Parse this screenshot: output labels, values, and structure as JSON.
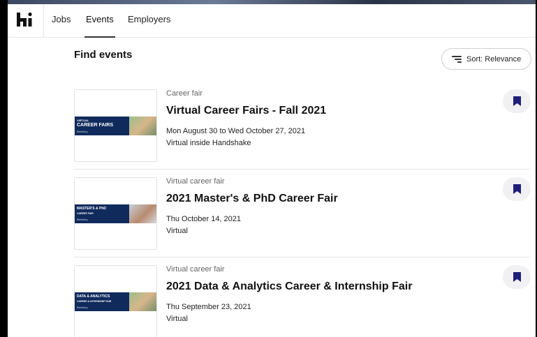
{
  "nav": {
    "tabs": [
      {
        "label": "Jobs"
      },
      {
        "label": "Events",
        "active": true
      },
      {
        "label": "Employers"
      }
    ]
  },
  "header": {
    "title": "Find events",
    "sort_label": "Sort: Relevance"
  },
  "events": [
    {
      "type": "Career fair",
      "title": "Virtual Career Fairs - Fall 2021",
      "date": "Mon August 30 to Wed October 27, 2021",
      "location": "Virtual inside Handshake",
      "banner_title": "CAREER FAIRS",
      "banner_kicker": "VIRTUAL",
      "banner_sub": "Berkeley",
      "bookmarked": true
    },
    {
      "type": "Virtual career fair",
      "title": "2021 Master's & PhD Career Fair",
      "date": "Thu October 14, 2021",
      "location": "Virtual",
      "banner_title": "MASTER'S & PhD",
      "banner_kicker": "CAREER FAIR",
      "banner_sub": "Berkeley",
      "bookmarked": true
    },
    {
      "type": "Virtual career fair",
      "title": "2021 Data & Analytics Career & Internship Fair",
      "date": "Thu September 23, 2021",
      "location": "Virtual",
      "banner_title": "DATA & ANALYTICS",
      "banner_kicker": "CAREER & INTERNSHIP FAIR",
      "banner_sub": "Berkeley",
      "bookmarked": true
    }
  ],
  "colors": {
    "accent": "#1f1f7a",
    "banner": "#102a5c"
  },
  "icons": {
    "logo": "handshake-logo-icon",
    "sort": "sort-lines-icon",
    "bookmark": "bookmark-icon"
  }
}
